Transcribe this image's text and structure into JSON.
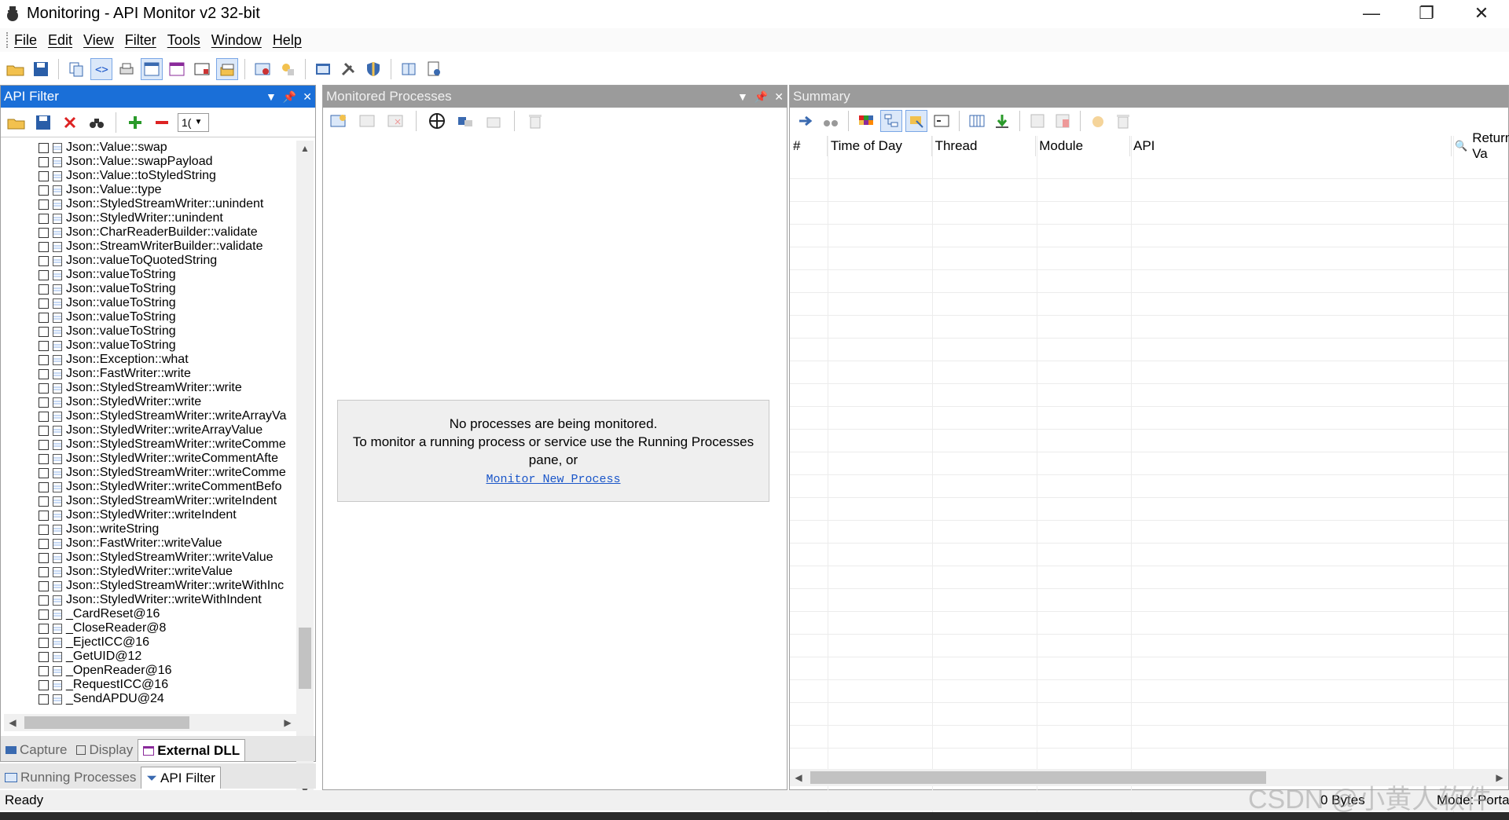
{
  "window": {
    "title": "Monitoring - API Monitor v2 32-bit",
    "controls": {
      "minimize": "—",
      "restore": "❐",
      "close": "✕"
    }
  },
  "menu": [
    "File",
    "Edit",
    "View",
    "Filter",
    "Tools",
    "Window",
    "Help"
  ],
  "api_filter": {
    "title": "API Filter",
    "toolbar_combo": "1(",
    "items": [
      "Json::Value::swap",
      "Json::Value::swapPayload",
      "Json::Value::toStyledString",
      "Json::Value::type",
      "Json::StyledStreamWriter::unindent",
      "Json::StyledWriter::unindent",
      "Json::CharReaderBuilder::validate",
      "Json::StreamWriterBuilder::validate",
      "Json::valueToQuotedString",
      "Json::valueToString",
      "Json::valueToString",
      "Json::valueToString",
      "Json::valueToString",
      "Json::valueToString",
      "Json::valueToString",
      "Json::Exception::what",
      "Json::FastWriter::write",
      "Json::StyledStreamWriter::write",
      "Json::StyledWriter::write",
      "Json::StyledStreamWriter::writeArrayVa",
      "Json::StyledWriter::writeArrayValue",
      "Json::StyledStreamWriter::writeComme",
      "Json::StyledWriter::writeCommentAfte",
      "Json::StyledStreamWriter::writeComme",
      "Json::StyledWriter::writeCommentBefo",
      "Json::StyledStreamWriter::writeIndent",
      "Json::StyledWriter::writeIndent",
      "Json::writeString",
      "Json::FastWriter::writeValue",
      "Json::StyledStreamWriter::writeValue",
      "Json::StyledWriter::writeValue",
      "Json::StyledStreamWriter::writeWithInc",
      "Json::StyledWriter::writeWithIndent",
      "_CardReset@16",
      "_CloseReader@8",
      "_EjectICC@16",
      "_GetUID@12",
      "_OpenReader@16",
      "_RequestICC@16",
      "_SendAPDU@24"
    ],
    "tabs": [
      "Capture",
      "Display",
      "External DLL"
    ],
    "bottom_tabs": [
      "Running Processes",
      "API Filter"
    ]
  },
  "monitored": {
    "title": "Monitored Processes",
    "message_line1": "No processes are being monitored.",
    "message_line2": "To monitor a running process or service use the Running Processes",
    "message_line3": "pane, or",
    "link": "Monitor New Process"
  },
  "summary": {
    "title": "Summary",
    "columns": [
      "#",
      "Time of Day",
      "Thread",
      "Module",
      "API",
      "Return Va"
    ]
  },
  "status": {
    "text": "Ready",
    "bytes": "0 Bytes",
    "mode": "Mode: Porta"
  },
  "watermark": "CSDN @小黄人软件"
}
